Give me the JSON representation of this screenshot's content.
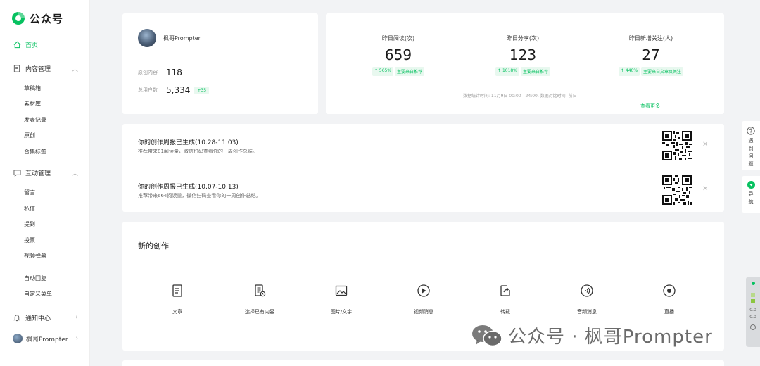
{
  "app": {
    "title": "公众号"
  },
  "sidebar": {
    "home": "首页",
    "content_group": {
      "label": "内容管理",
      "items": [
        "草稿箱",
        "素材库",
        "发表记录",
        "原创",
        "合集标签"
      ]
    },
    "interaction_group": {
      "label": "互动管理",
      "items": [
        "留言",
        "私信",
        "提到",
        "投票",
        "视频弹幕"
      ]
    },
    "extra_items": [
      "自动回复",
      "自定义菜单"
    ],
    "notifications": "通知中心",
    "account": "枫哥Prompter"
  },
  "profile": {
    "name": "枫哥Prompter",
    "original_label": "原创内容",
    "original_value": "118",
    "users_label": "总用户数",
    "users_value": "5,334",
    "users_delta": "+35"
  },
  "stats": {
    "items": [
      {
        "label": "昨日阅读(次)",
        "value": "659",
        "change": "↑ 565%",
        "source": "主要来自推荐"
      },
      {
        "label": "昨日分享(次)",
        "value": "123",
        "change": "↑ 1018%",
        "source": "主要来自推荐"
      },
      {
        "label": "昨日新增关注(人)",
        "value": "27",
        "change": "↑ 440%",
        "source": "主要来自文章页关注"
      }
    ],
    "note": "数据统计时间: 11月9日 00:00 - 24:00, 数据对比时间: 前日",
    "more": "查看更多"
  },
  "reports": [
    {
      "title": "你的创作周报已生成(10.28-11.03)",
      "desc": "推荐带来81阅读量，微信扫码查看你的一周创作总结。"
    },
    {
      "title": "你的创作周报已生成(10.07-10.13)",
      "desc": "推荐带来664阅读量，微信扫码查看你的一周创作总结。"
    }
  ],
  "create": {
    "title": "新的创作",
    "items": [
      "文章",
      "选择已有内容",
      "图片/文字",
      "视频消息",
      "转载",
      "音频消息",
      "直播"
    ]
  },
  "side_tools": {
    "help": [
      "遇",
      "到",
      "问",
      "题"
    ],
    "nav": [
      "导",
      "航"
    ]
  },
  "panel": {
    "v1": "0.0",
    "v2": "0.0"
  },
  "watermark": "公众号 · 枫哥Prompter",
  "colors": {
    "accent": "#07c160",
    "background": "#f2f3f5"
  }
}
